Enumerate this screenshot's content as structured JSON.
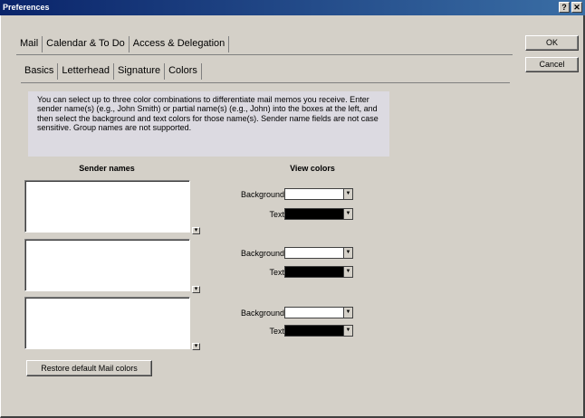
{
  "window": {
    "title": "Preferences"
  },
  "main_tabs": [
    {
      "label": "Mail"
    },
    {
      "label": "Calendar & To Do"
    },
    {
      "label": "Access & Delegation"
    }
  ],
  "sub_tabs": [
    {
      "label": "Basics"
    },
    {
      "label": "Letterhead"
    },
    {
      "label": "Signature"
    },
    {
      "label": "Colors"
    }
  ],
  "buttons": {
    "ok": "OK",
    "cancel": "Cancel",
    "restore": "Restore default Mail colors"
  },
  "info_text": "You can select up to three color combinations to differentiate mail memos you receive.  Enter sender name(s) (e.g., John Smith) or partial name(s) (e.g., John) into the boxes at the left, and then select the background and text colors for those name(s).  Sender name fields are not case sensitive.  Group names are not supported.",
  "headings": {
    "sender_names": "Sender names",
    "view_colors": "View colors"
  },
  "color_rows": [
    {
      "background_label": "Background",
      "text_label": "Text",
      "background_color": "#ffffff",
      "text_color": "#000000"
    },
    {
      "background_label": "Background",
      "text_label": "Text",
      "background_color": "#ffffff",
      "text_color": "#000000"
    },
    {
      "background_label": "Background",
      "text_label": "Text",
      "background_color": "#ffffff",
      "text_color": "#000000"
    }
  ],
  "icons": [
    "help-icon",
    "close-icon",
    "dropdown-arrow-icon",
    "scroll-arrow-icon"
  ]
}
